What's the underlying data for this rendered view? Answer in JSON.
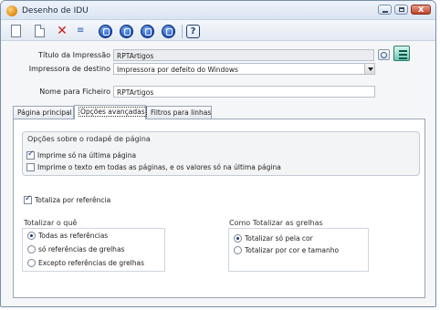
{
  "window": {
    "title": "Desenho de IDU",
    "minimize_glyph": "",
    "maximize_glyph": "",
    "close_glyph": "x"
  },
  "toolbar": {
    "items": [
      "new-document-icon",
      "copy-document-icon",
      "delete-icon",
      "properties-icon",
      "first-record-icon",
      "previous-record-icon",
      "next-record-icon",
      "last-record-icon",
      "help-icon"
    ],
    "help_glyph": "?",
    "delete_glyph": "✕",
    "props_glyph": "≡"
  },
  "form": {
    "title_label": "Título da Impressão",
    "title_value": "RPTArtigos",
    "printer_label": "Impressora de destino",
    "printer_value": "Impressora por defeito do Windows",
    "filename_label": "Nome para Ficheiro",
    "filename_value": "RPTArtigos"
  },
  "tabs": [
    {
      "label": "Página principal",
      "active": false
    },
    {
      "label": "Opções avançadas",
      "active": true
    },
    {
      "label": "Filtros para linhas",
      "active": false
    }
  ],
  "footer_options": {
    "title": "Opções sobre o rodapé de página",
    "print_last_page_label": "Imprime só na última página",
    "print_last_page_checked": true,
    "print_text_all_pages_label": "Imprime o texto em todas as páginas, e os valores só na última página",
    "print_text_all_pages_checked": false
  },
  "totals": {
    "by_reference_label": "Totaliza por referência",
    "by_reference_checked": true,
    "what_title": "Totalizar o quê",
    "what_options": [
      {
        "label": "Todas as referências",
        "selected": true
      },
      {
        "label": "só referências de grelhas",
        "selected": false
      },
      {
        "label": "Excepto referências de grelhas",
        "selected": false
      }
    ],
    "how_title": "Como Totalizar as grelhas",
    "how_options": [
      {
        "label": "Totalizar só pela cor",
        "selected": true
      },
      {
        "label": "Totalizar por cor e tamanho",
        "selected": false
      }
    ]
  }
}
